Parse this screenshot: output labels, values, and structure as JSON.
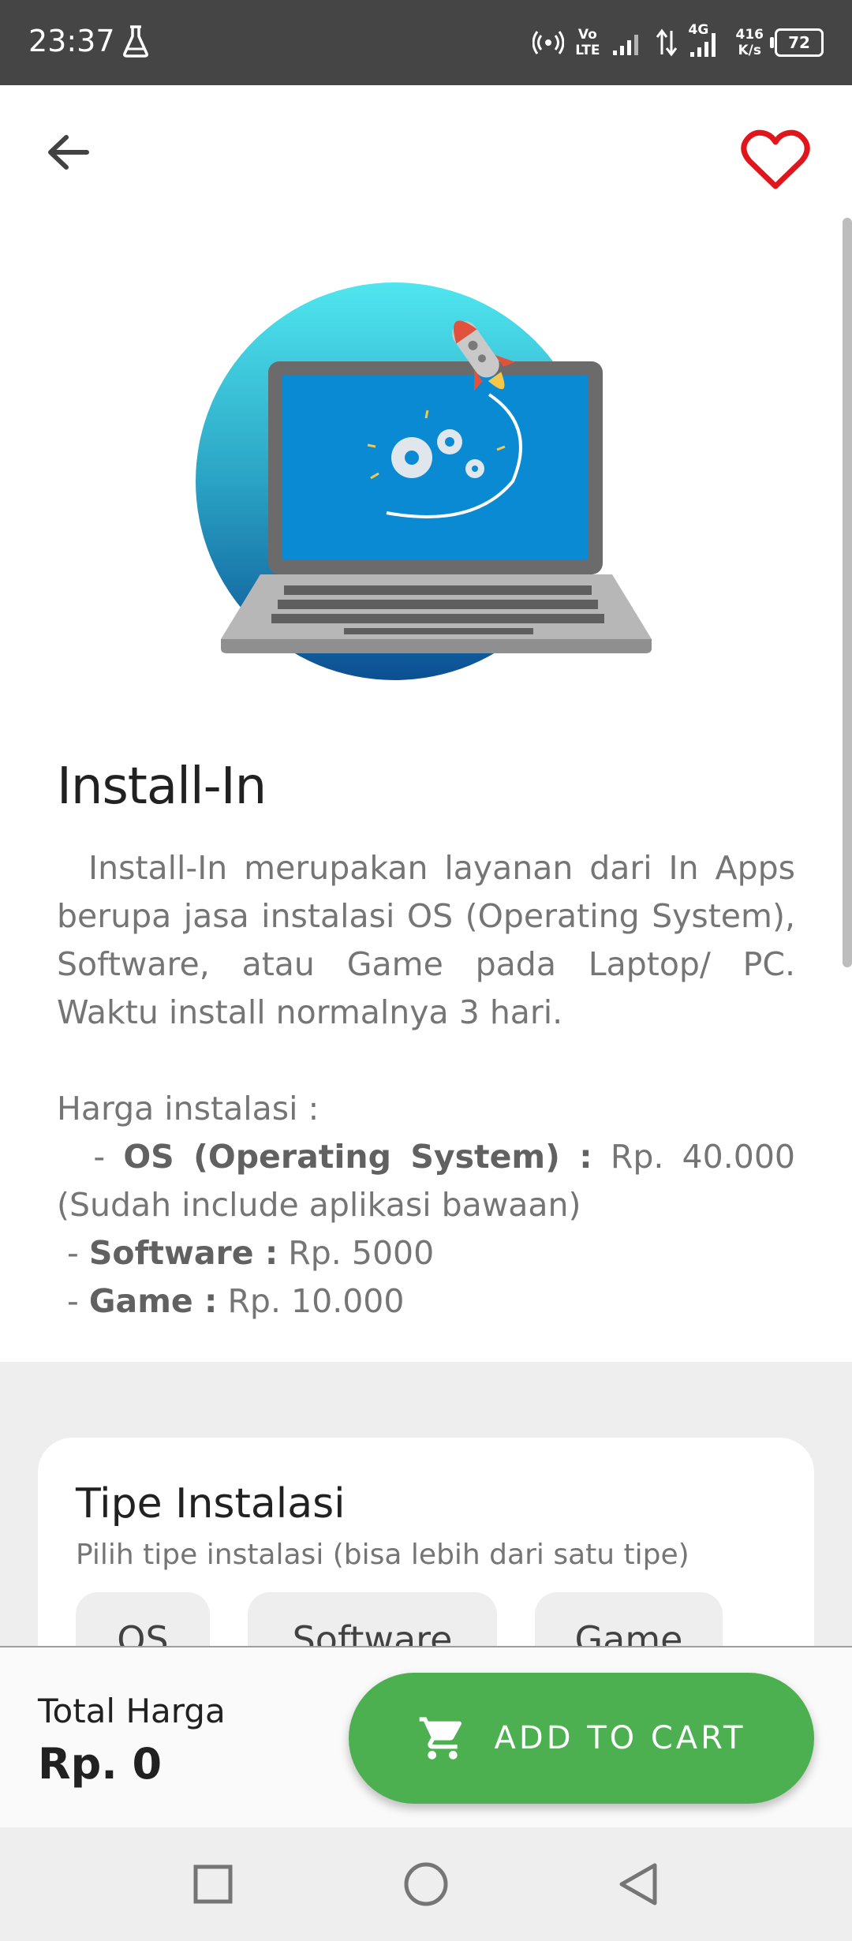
{
  "status_bar": {
    "time": "23:37",
    "network_label_top": "Vo",
    "network_label_bottom": "LTE",
    "gen_label": "4G",
    "speed_value": "416",
    "speed_unit": "K/s",
    "battery": "72"
  },
  "product": {
    "title": "Install-In",
    "description": "Install-In merupakan layanan dari In Apps berupa jasa instalasi OS (Operating System), Software, atau Game pada Laptop/ PC. Waktu install normalnya 3 hari.",
    "price_heading": "Harga instalasi :",
    "prices": [
      {
        "prefix": "  - ",
        "label": "OS (Operating System) :",
        "value": " Rp. 40.000 (Sudah include aplikasi bawaan)"
      },
      {
        "prefix": " - ",
        "label": "Software :",
        "value": " Rp. 5000"
      },
      {
        "prefix": " - ",
        "label": "Game :",
        "value": " Rp. 10.000"
      }
    ]
  },
  "install_type": {
    "title": "Tipe Instalasi",
    "subtitle": "Pilih tipe instalasi (bisa lebih dari satu tipe)",
    "options": [
      "OS",
      "Software",
      "Game"
    ]
  },
  "footer": {
    "total_label": "Total Harga",
    "total_value": "Rp. 0",
    "cart_button": "ADD TO CART"
  },
  "colors": {
    "accent_green": "#4caf50",
    "favorite_red": "#e0161c",
    "status_bar": "#454545"
  },
  "icons": [
    "back-arrow-icon",
    "heart-outline-icon",
    "cart-icon",
    "recents-square-icon",
    "home-circle-icon",
    "back-triangle-icon"
  ]
}
